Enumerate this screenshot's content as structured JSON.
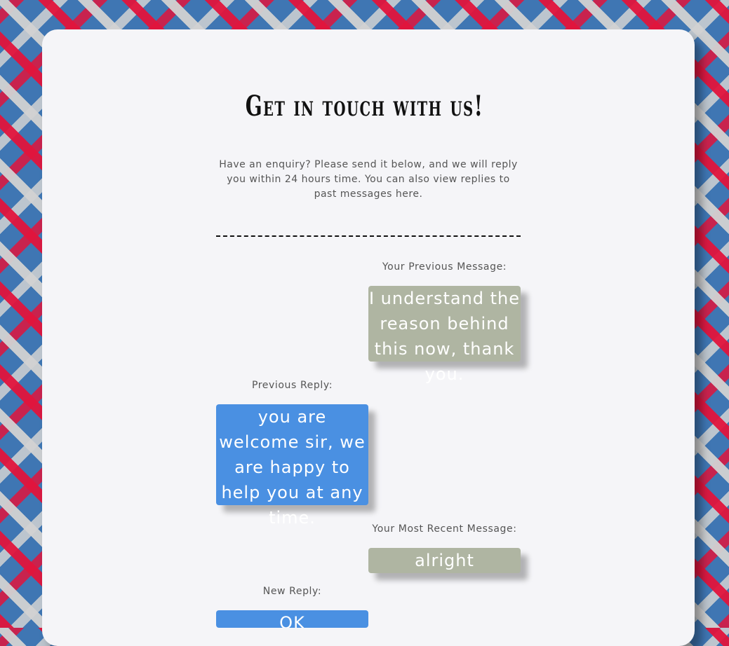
{
  "page": {
    "title": "Get in touch with us!",
    "intro": "Have an enquiry? Please send it below, and we will reply you within 24 hours time. You can also view replies to past messages here."
  },
  "conversation": {
    "previous_message_label": "Your Previous Message:",
    "previous_message": "I understand the reason behind this now, thank you.",
    "previous_reply_label": "Previous Reply:",
    "previous_reply": "you are welcome sir, we are happy to help you at any time.",
    "recent_message_label": "Your Most Recent Message:",
    "recent_message": "alright",
    "new_reply_label": "New Reply:",
    "new_reply": "OK"
  },
  "colors": {
    "user_bubble": "#afb5a2",
    "reply_bubble": "#4a90e2",
    "card": "#f5f5f8",
    "background_blue": "#3f76b3",
    "background_red": "#e1143c"
  }
}
